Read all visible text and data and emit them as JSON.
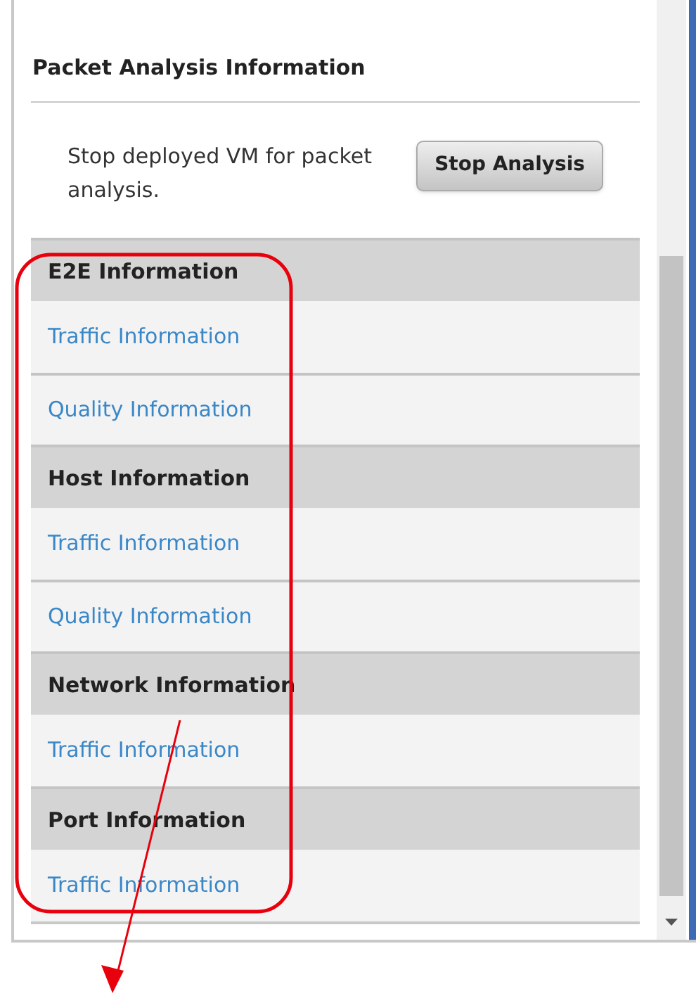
{
  "panel": {
    "title": "Packet Analysis Information",
    "description": "Stop deployed VM for packet analysis.",
    "button": "Stop Analysis"
  },
  "sections": [
    {
      "title": "E2E Information",
      "links": [
        "Traffic Information",
        "Quality Information"
      ]
    },
    {
      "title": "Host Information",
      "links": [
        "Traffic Information",
        "Quality Information"
      ]
    },
    {
      "title": "Network Information",
      "links": [
        "Traffic Information"
      ]
    },
    {
      "title": "Port Information",
      "links": [
        "Traffic Information"
      ]
    }
  ]
}
